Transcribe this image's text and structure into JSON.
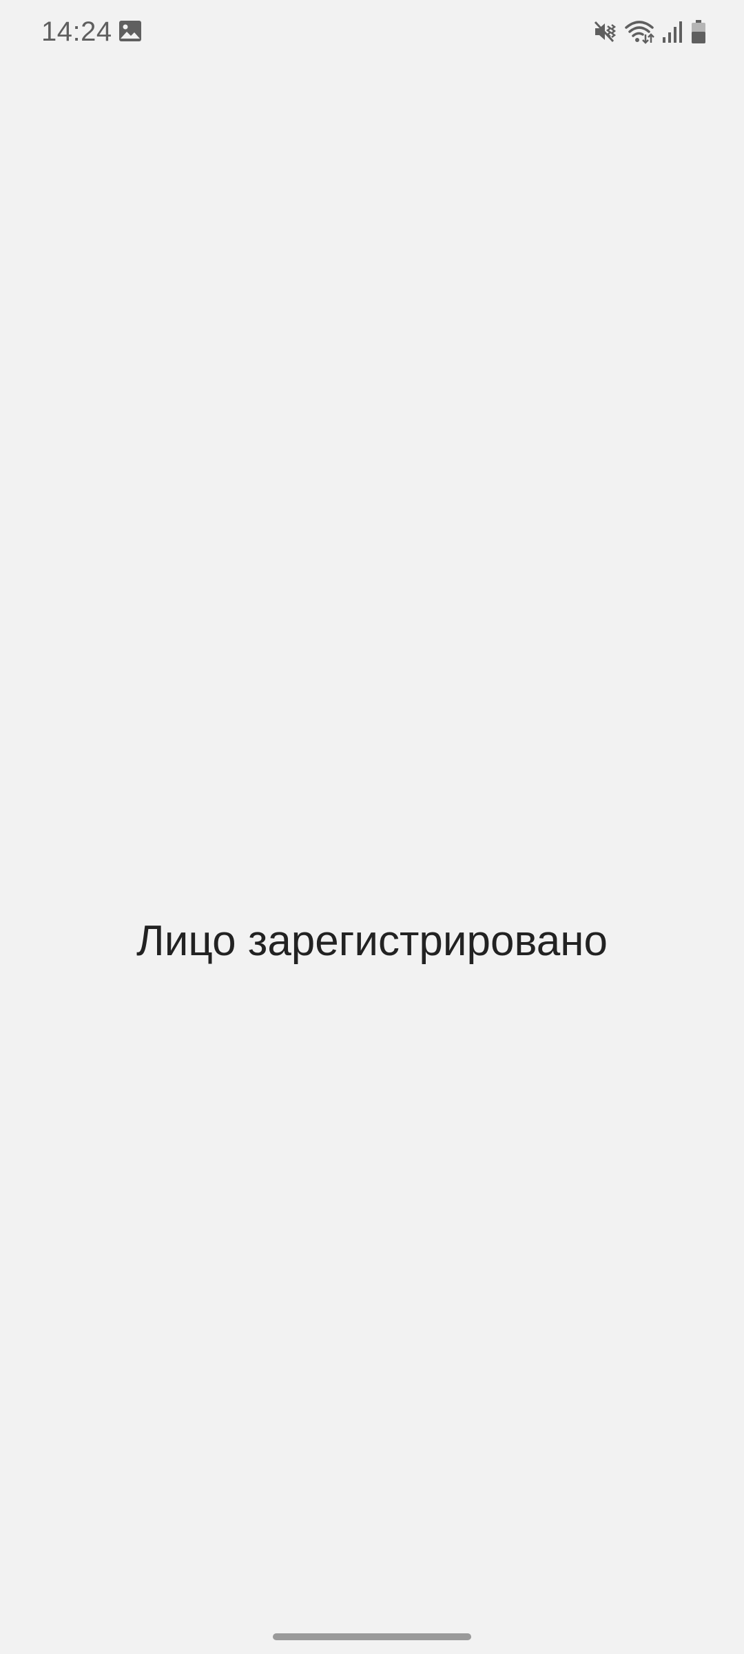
{
  "status_bar": {
    "time": "14:24",
    "icons": {
      "notification": "gallery-icon",
      "sound": "vibrate-mute-icon",
      "wifi": "wifi-icon",
      "signal": "signal-icon",
      "battery": "battery-icon"
    },
    "icon_color": "#5f5f5f"
  },
  "main": {
    "message": "Лицо зарегистрировано",
    "background": "#f2f2f2",
    "text_color": "#222222"
  },
  "nav": {
    "handle": "home-gesture-handle"
  }
}
